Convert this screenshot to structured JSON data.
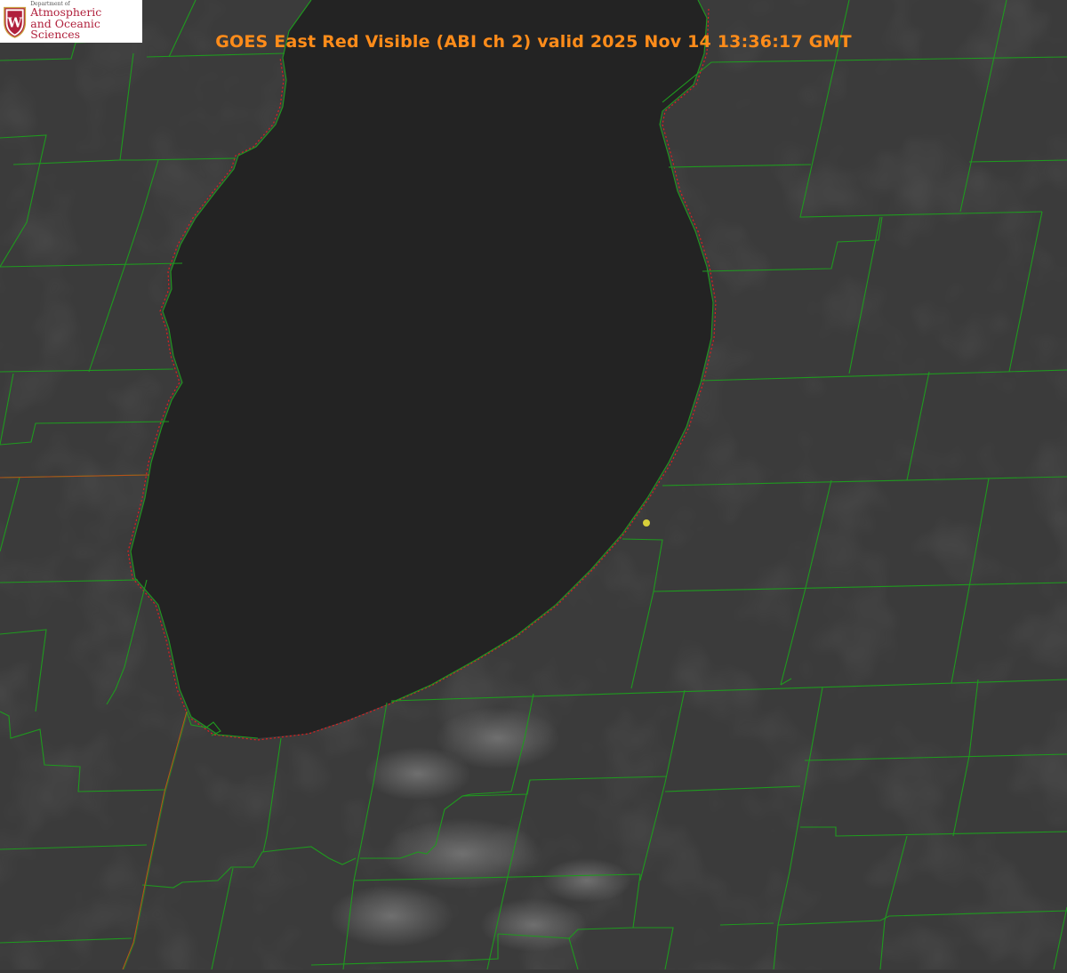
{
  "map": {
    "title": "GOES East Red Visible (ABI ch 2) valid 2025 Nov 14 13:36:17 GMT",
    "product": "GOES East Red Visible (ABI ch 2)",
    "valid_time": "2025 Nov 14 13:36:17 GMT",
    "colors": {
      "land": "#3a3a3a",
      "lake": "#232323",
      "county_lines": "#1f9a1f",
      "coastline": "#e02020",
      "title_text": "#ff8c1a",
      "marker": "#d8cf3a"
    },
    "features": {
      "water_body": "lake",
      "boundaries": [
        "county-borders",
        "state-border",
        "shoreline"
      ],
      "marker": "station-dot"
    }
  },
  "logo": {
    "line1": "Department of",
    "line2": "Atmospheric",
    "line3": "and Oceanic Sciences",
    "seal_letter": "W",
    "seal_color": "#b0203c"
  }
}
